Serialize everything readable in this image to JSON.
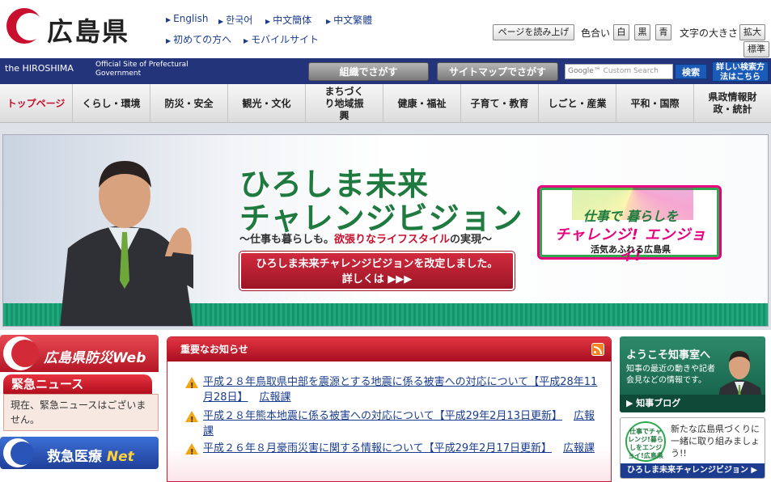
{
  "header": {
    "site_title": "広島県",
    "lang_links": [
      "English",
      "한국어",
      "中文簡体",
      "中文繁體"
    ],
    "sub_links": [
      "初めての方へ",
      "モバイルサイト"
    ],
    "read_aloud": "ページを読み上げ",
    "color_label": "色合い",
    "color_options": [
      "白",
      "黒",
      "青"
    ],
    "font_size_label": "文字の大きさ",
    "font_enlarge": "拡大",
    "font_standard": "標準"
  },
  "band": {
    "the_hiroshima": "the HIROSHIMA",
    "official_site": "Official Site of Prefectural Government",
    "search_by_org": "組織でさがす",
    "search_by_sitemap": "サイトマップでさがす",
    "search_placeholder": "Custom Search",
    "search_google": "Google™",
    "search_button": "検索",
    "detail_search": "詳しい検索方法はこちら"
  },
  "nav": {
    "items": [
      "トップページ",
      "くらし・環境",
      "防災・安全",
      "観光・文化",
      "まちづくり地域振興",
      "健康・福祉",
      "子育て・教育",
      "しごと・産業",
      "平和・国際",
      "県政情報財政・統計"
    ]
  },
  "hero": {
    "title_line1": "ひろしま未来",
    "title_line2": "チャレンジビジョン",
    "subtitle_pre": "～仕事も暮らしも。",
    "subtitle_red": "欲張りなライフスタイル",
    "subtitle_post": "の実現～",
    "button_line1": "ひろしま未来チャレンジビジョンを改定しました。",
    "button_line2": "詳しくは ▶▶▶",
    "logo_line1": "仕事で 暮らしを",
    "logo_line2": "チャレンジ! エンジョイ!",
    "logo_line3": "活気あふれる広島県"
  },
  "left": {
    "bousai_title": "広島県防災Web",
    "kinkyu_title": "緊急ニュース",
    "kinkyu_body": "現在、緊急ニュースはございません。",
    "kyukyu_title": "救急医療",
    "kyukyu_net": "Net"
  },
  "news": {
    "header": "重要なお知らせ",
    "items": [
      {
        "text": "平成２８年鳥取県中部を震源とする地震に係る被害への対応について【平成28年11月28日】",
        "dept": "広報課"
      },
      {
        "text": "平成２８年熊本地震に係る被害への対応について【平成29年2月13日更新】",
        "dept": "広報課"
      },
      {
        "text": "平成２６年８月豪雨災害に関する情報について【平成29年2月17日更新】",
        "dept": "広報課"
      }
    ]
  },
  "right": {
    "chiji_title": "ようこそ知事室へ",
    "chiji_desc": "知事の最近の動きや記者会見などの情報です。",
    "chiji_blog": "▶ 知事ブログ",
    "vision_logo_text": "仕事でチャレンジ!暮らしをエンジョイ!広島県",
    "vision_desc": "新たな広島県づくりに一緒に取り組みましょう!!",
    "vision_bar": "ひろしま未来チャレンジビジョン ▶"
  },
  "colors": {
    "brand_red": "#c8102e",
    "band_navy": "#24347a",
    "link_blue": "#1a3d8f",
    "hero_green": "#1e7a3e"
  }
}
